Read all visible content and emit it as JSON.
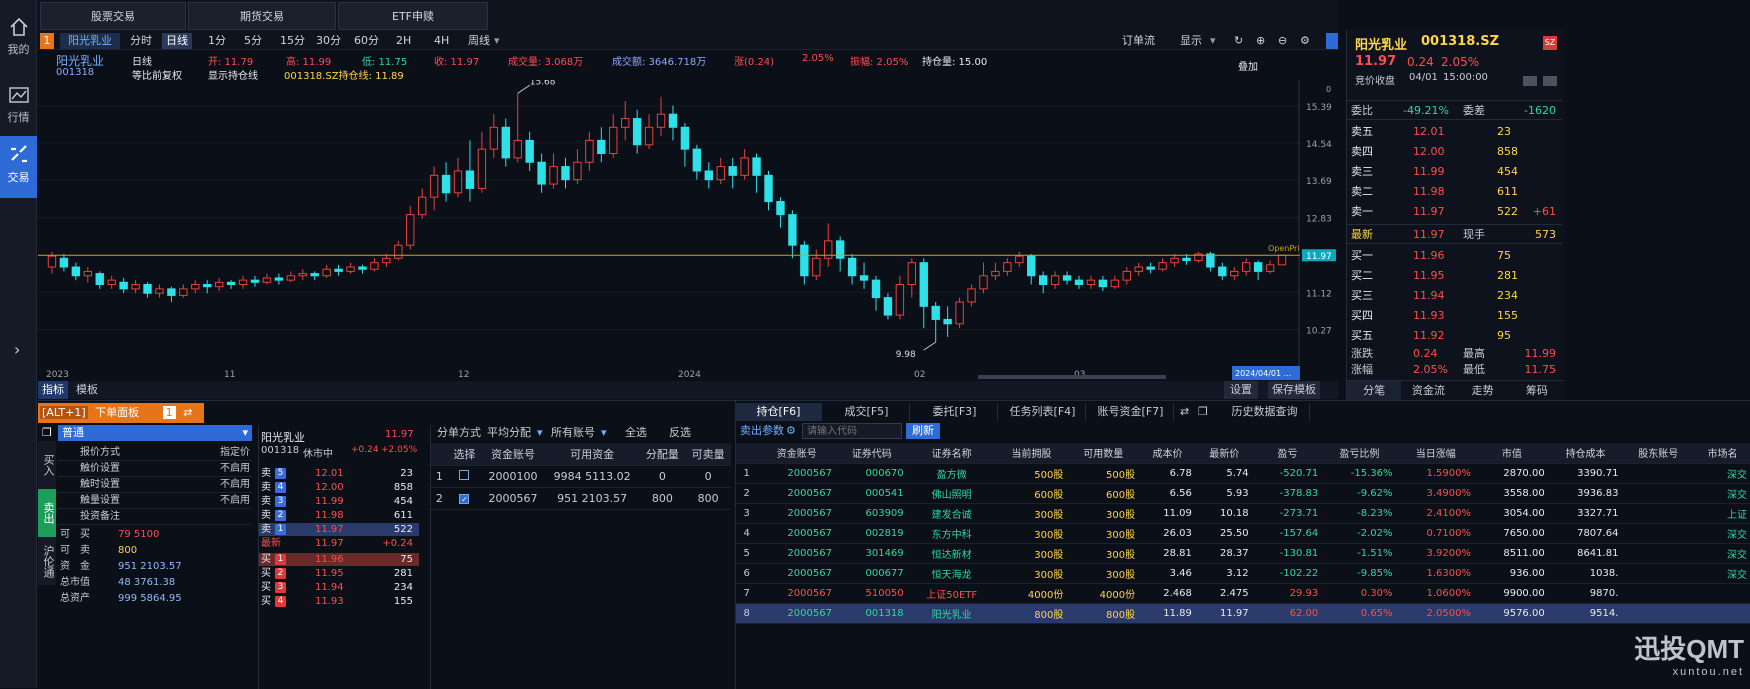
{
  "nav": [
    {
      "label": "我的"
    },
    {
      "label": "行情"
    },
    {
      "label": "交易"
    }
  ],
  "top_tabs": [
    "股票交易",
    "期货交易",
    "ETF申赎"
  ],
  "toolbar": {
    "badge": "1",
    "stock": "阳光乳业",
    "periods": [
      "分时",
      "日线",
      "1分",
      "5分",
      "15分",
      "30分",
      "60分",
      "2H",
      "4H",
      "周线"
    ],
    "selected": "日线",
    "order_flow": "订单流",
    "display": "显示"
  },
  "info": {
    "name": "阳光乳业",
    "code": "001318",
    "line": "日线",
    "adjust": "等比前复权",
    "open": "开: 11.79",
    "high": "高: 11.99",
    "low": "低: 11.75",
    "close": "收: 11.97",
    "volume": "成交量: 3.068万",
    "amount": "成交额: 3646.718万",
    "change": "涨(0.24)",
    "pct": "2.05%",
    "amp": "振幅: 2.05%",
    "position": "持仓量: 15.00",
    "show_cost": "显示持仓线",
    "cost_line": "001318.SZ持仓线: 11.89",
    "overlay": "叠加"
  },
  "chart_data": {
    "type": "candlestick",
    "x_ticks": [
      "2023",
      "11",
      "12",
      "2024",
      "02",
      "03"
    ],
    "y_ticks": [
      "15.39",
      "14.54",
      "13.69",
      "12.83",
      "11.97",
      "11.12",
      "10.27"
    ],
    "ylim": [
      9.8,
      15.8
    ],
    "max_label": "15.68",
    "min_label": "9.98",
    "hline": 11.97,
    "hline_label": "OpenPri",
    "last_date": "2024/04/01 ...",
    "current_tag": "11.97",
    "candles": [
      [
        11.7,
        11.95,
        11.55,
        12.05
      ],
      [
        11.9,
        11.7,
        11.6,
        12.0
      ],
      [
        11.7,
        11.5,
        11.4,
        11.8
      ],
      [
        11.5,
        11.6,
        11.35,
        11.7
      ],
      [
        11.55,
        11.3,
        11.2,
        11.6
      ],
      [
        11.3,
        11.4,
        11.2,
        11.5
      ],
      [
        11.35,
        11.2,
        11.1,
        11.45
      ],
      [
        11.2,
        11.3,
        11.1,
        11.4
      ],
      [
        11.3,
        11.1,
        11.0,
        11.35
      ],
      [
        11.1,
        11.2,
        11.0,
        11.3
      ],
      [
        11.2,
        11.05,
        10.9,
        11.25
      ],
      [
        11.05,
        11.2,
        11.0,
        11.3
      ],
      [
        11.2,
        11.3,
        11.1,
        11.4
      ],
      [
        11.3,
        11.25,
        11.1,
        11.4
      ],
      [
        11.25,
        11.35,
        11.15,
        11.45
      ],
      [
        11.35,
        11.3,
        11.2,
        11.4
      ],
      [
        11.3,
        11.4,
        11.2,
        11.5
      ],
      [
        11.4,
        11.35,
        11.25,
        11.5
      ],
      [
        11.35,
        11.45,
        11.3,
        11.55
      ],
      [
        11.45,
        11.4,
        11.3,
        11.55
      ],
      [
        11.4,
        11.5,
        11.35,
        11.6
      ],
      [
        11.5,
        11.55,
        11.4,
        11.65
      ],
      [
        11.55,
        11.5,
        11.4,
        11.6
      ],
      [
        11.5,
        11.65,
        11.45,
        11.75
      ],
      [
        11.65,
        11.6,
        11.5,
        11.75
      ],
      [
        11.6,
        11.7,
        11.55,
        11.8
      ],
      [
        11.7,
        11.65,
        11.55,
        11.75
      ],
      [
        11.65,
        11.8,
        11.6,
        11.9
      ],
      [
        11.8,
        11.9,
        11.7,
        12.0
      ],
      [
        11.9,
        12.2,
        11.85,
        12.3
      ],
      [
        12.2,
        12.9,
        12.1,
        13.1
      ],
      [
        12.9,
        13.3,
        12.8,
        13.5
      ],
      [
        13.3,
        13.8,
        13.0,
        14.0
      ],
      [
        13.8,
        13.4,
        13.2,
        14.1
      ],
      [
        13.4,
        13.9,
        13.3,
        14.2
      ],
      [
        13.9,
        13.5,
        13.2,
        14.6
      ],
      [
        13.5,
        14.4,
        13.4,
        14.8
      ],
      [
        14.4,
        14.9,
        14.2,
        15.2
      ],
      [
        14.9,
        14.2,
        14.0,
        15.1
      ],
      [
        14.2,
        14.6,
        14.1,
        15.68
      ],
      [
        14.6,
        14.1,
        13.9,
        14.8
      ],
      [
        14.1,
        13.6,
        13.4,
        14.3
      ],
      [
        13.6,
        14.0,
        13.5,
        14.3
      ],
      [
        14.0,
        13.7,
        13.5,
        14.2
      ],
      [
        13.7,
        14.1,
        13.6,
        14.4
      ],
      [
        14.1,
        14.6,
        13.9,
        14.8
      ],
      [
        14.6,
        14.3,
        14.1,
        14.9
      ],
      [
        14.3,
        14.9,
        14.2,
        15.2
      ],
      [
        14.9,
        15.1,
        14.6,
        15.5
      ],
      [
        15.1,
        14.5,
        14.3,
        15.3
      ],
      [
        14.5,
        14.9,
        14.4,
        15.2
      ],
      [
        14.9,
        15.2,
        14.7,
        15.6
      ],
      [
        15.2,
        14.9,
        14.6,
        15.4
      ],
      [
        14.9,
        14.4,
        14.0,
        15.0
      ],
      [
        14.4,
        13.9,
        13.7,
        14.5
      ],
      [
        13.9,
        13.7,
        13.5,
        14.1
      ],
      [
        13.7,
        14.0,
        13.6,
        14.2
      ],
      [
        14.0,
        13.8,
        13.5,
        14.2
      ],
      [
        13.8,
        14.2,
        13.7,
        14.4
      ],
      [
        14.2,
        13.8,
        13.4,
        14.3
      ],
      [
        13.8,
        13.2,
        13.0,
        13.9
      ],
      [
        13.2,
        12.9,
        12.6,
        13.3
      ],
      [
        12.9,
        12.2,
        11.9,
        13.0
      ],
      [
        12.2,
        11.5,
        11.3,
        12.3
      ],
      [
        11.5,
        11.9,
        11.4,
        12.1
      ],
      [
        11.9,
        12.3,
        11.7,
        12.7
      ],
      [
        12.3,
        11.9,
        11.6,
        12.4
      ],
      [
        11.9,
        11.5,
        11.3,
        12.0
      ],
      [
        11.5,
        11.4,
        11.2,
        11.8
      ],
      [
        11.4,
        11.0,
        10.7,
        11.5
      ],
      [
        11.0,
        10.6,
        10.5,
        11.1
      ],
      [
        10.6,
        11.3,
        10.5,
        11.5
      ],
      [
        11.3,
        11.8,
        11.0,
        11.9
      ],
      [
        11.8,
        10.8,
        10.3,
        11.9
      ],
      [
        10.8,
        10.5,
        9.98,
        10.9
      ],
      [
        10.5,
        10.4,
        10.1,
        10.8
      ],
      [
        10.4,
        10.9,
        10.3,
        11.0
      ],
      [
        10.9,
        11.2,
        10.8,
        11.3
      ],
      [
        11.2,
        11.5,
        11.1,
        11.8
      ],
      [
        11.5,
        11.6,
        11.4,
        11.8
      ],
      [
        11.6,
        11.8,
        11.5,
        11.9
      ],
      [
        11.8,
        11.95,
        11.7,
        12.05
      ],
      [
        11.95,
        11.5,
        11.3,
        12.0
      ],
      [
        11.5,
        11.3,
        11.1,
        11.6
      ],
      [
        11.3,
        11.5,
        11.2,
        11.6
      ],
      [
        11.5,
        11.4,
        11.3,
        11.6
      ],
      [
        11.4,
        11.3,
        11.2,
        11.5
      ],
      [
        11.3,
        11.4,
        11.2,
        11.5
      ],
      [
        11.4,
        11.25,
        11.15,
        11.5
      ],
      [
        11.25,
        11.4,
        11.2,
        11.5
      ],
      [
        11.4,
        11.6,
        11.3,
        11.7
      ],
      [
        11.6,
        11.7,
        11.5,
        11.8
      ],
      [
        11.7,
        11.65,
        11.55,
        11.8
      ],
      [
        11.65,
        11.8,
        11.6,
        11.9
      ],
      [
        11.8,
        11.9,
        11.7,
        12.0
      ],
      [
        11.9,
        11.85,
        11.75,
        12.0
      ],
      [
        11.85,
        12.0,
        11.8,
        12.05
      ],
      [
        12.0,
        11.7,
        11.6,
        12.05
      ],
      [
        11.7,
        11.5,
        11.4,
        11.8
      ],
      [
        11.5,
        11.6,
        11.4,
        11.7
      ],
      [
        11.6,
        11.8,
        11.5,
        11.9
      ],
      [
        11.8,
        11.6,
        11.4,
        11.85
      ],
      [
        11.6,
        11.75,
        11.55,
        11.85
      ],
      [
        11.75,
        11.97,
        11.75,
        11.99
      ]
    ]
  },
  "indicator_bar": {
    "tabs": [
      "指标",
      "模板"
    ],
    "settings": "设置",
    "save": "保存模板"
  },
  "right": {
    "name": "阳光乳业",
    "code": "001318.SZ",
    "price": "11.97",
    "chg": "0.24",
    "pct": "2.05%",
    "auction": "竞价收盘",
    "date": "04/01",
    "time": "15:00:00",
    "weibi_label": "委比",
    "weibi": "-49.21%",
    "weicha_label": "委差",
    "weicha": "-1620",
    "asks": [
      {
        "l": "卖五",
        "p": "12.01",
        "v": "23",
        "d": ""
      },
      {
        "l": "卖四",
        "p": "12.00",
        "v": "858",
        "d": ""
      },
      {
        "l": "卖三",
        "p": "11.99",
        "v": "454",
        "d": ""
      },
      {
        "l": "卖二",
        "p": "11.98",
        "v": "611",
        "d": ""
      },
      {
        "l": "卖一",
        "p": "11.97",
        "v": "522",
        "d": "+61"
      }
    ],
    "last_label": "最新",
    "last": "11.97",
    "hand_label": "现手",
    "hand": "573",
    "bids": [
      {
        "l": "买一",
        "p": "11.96",
        "v": "75"
      },
      {
        "l": "买二",
        "p": "11.95",
        "v": "281"
      },
      {
        "l": "买三",
        "p": "11.94",
        "v": "234"
      },
      {
        "l": "买四",
        "p": "11.93",
        "v": "155"
      },
      {
        "l": "买五",
        "p": "11.92",
        "v": "95"
      }
    ],
    "stats": [
      {
        "a": "涨跌",
        "b": "0.24",
        "c": "最高",
        "d": "11.99"
      },
      {
        "a": "涨幅",
        "b": "2.05%",
        "c": "最低",
        "d": "11.75"
      }
    ],
    "tabs": [
      "分笔",
      "资金流",
      "走势",
      "筹码"
    ]
  },
  "order": {
    "alt": "[ALT+1]",
    "panel": "下单面板",
    "badge": "1",
    "side_tabs": [
      "买入",
      "卖出",
      "沪伦通"
    ],
    "type": "普通",
    "rows": [
      {
        "k": "报价方式",
        "v": "指定价"
      },
      {
        "k": "触价设置",
        "v": "不启用"
      },
      {
        "k": "触时设置",
        "v": "不启用"
      },
      {
        "k": "触量设置",
        "v": "不启用"
      },
      {
        "k": "投资备注",
        "v": ""
      }
    ],
    "acct": [
      {
        "k": "可　买",
        "v": "79 5100"
      },
      {
        "k": "可　卖",
        "v": "800"
      },
      {
        "k": "资　金",
        "v": "951 2103.57"
      },
      {
        "k": "总市值",
        "v": "48 3761.38"
      },
      {
        "k": "总资产",
        "v": "999 5864.95"
      }
    ]
  },
  "quote": {
    "name": "阳光乳业",
    "price": "11.97",
    "code": "001318",
    "status": "休市中",
    "chg": "+0.24",
    "pct": "+2.05%",
    "asks": [
      {
        "l": "卖",
        "n": "5",
        "p": "12.01",
        "v": "23"
      },
      {
        "l": "卖",
        "n": "4",
        "p": "12.00",
        "v": "858"
      },
      {
        "l": "卖",
        "n": "3",
        "p": "11.99",
        "v": "454"
      },
      {
        "l": "卖",
        "n": "2",
        "p": "11.98",
        "v": "611"
      },
      {
        "l": "卖",
        "n": "1",
        "p": "11.97",
        "v": "522"
      }
    ],
    "last_label": "最新",
    "last": "11.97",
    "last_chg": "+0.24",
    "bids": [
      {
        "l": "买",
        "n": "1",
        "p": "11.96",
        "v": "75"
      },
      {
        "l": "买",
        "n": "2",
        "p": "11.95",
        "v": "281"
      },
      {
        "l": "买",
        "n": "3",
        "p": "11.94",
        "v": "234"
      },
      {
        "l": "买",
        "n": "4",
        "p": "11.93",
        "v": "155"
      }
    ]
  },
  "split": {
    "label": "分单方式",
    "mode": "平均分配",
    "accounts": "所有账号",
    "all": "全选",
    "invert": "反选",
    "headers": [
      "选择",
      "资金账号",
      "可用资金",
      "分配量",
      "可卖量"
    ],
    "rows": [
      {
        "i": "1",
        "acc": "2000100",
        "cash": "9984 5113.02",
        "alloc": "0",
        "sell": "0",
        "checked": false
      },
      {
        "i": "2",
        "acc": "2000567",
        "cash": "951 2103.57",
        "alloc": "800",
        "sell": "800",
        "checked": true
      }
    ]
  },
  "holdings": {
    "tabs": [
      "持仓[F6]",
      "成交[F5]",
      "委托[F3]",
      "任务列表[F4]",
      "账号资金[F7]",
      "历史数据查询"
    ],
    "sell_param": "卖出参数",
    "placeholder": "请输入代码",
    "refresh": "刷新",
    "headers": [
      "",
      "资金账号",
      "证券代码",
      "证券名称",
      "当前拥股",
      "可用数量",
      "成本价",
      "最新价",
      "盈亏",
      "盈亏比例",
      "当日涨幅",
      "市值",
      "持仓成本",
      "股东账号",
      "市场名"
    ],
    "rows": [
      [
        "1",
        "2000567",
        "000670",
        "盈方微",
        "500股",
        "500股",
        "6.78",
        "5.74",
        "-520.71",
        "-15.36%",
        "1.5900%",
        "2870.00",
        "3390.71",
        "",
        "深交"
      ],
      [
        "2",
        "2000567",
        "000541",
        "佛山照明",
        "600股",
        "600股",
        "6.56",
        "5.93",
        "-378.83",
        "-9.62%",
        "3.4900%",
        "3558.00",
        "3936.83",
        "",
        "深交"
      ],
      [
        "3",
        "2000567",
        "603909",
        "建发合诚",
        "300股",
        "300股",
        "11.09",
        "10.18",
        "-273.71",
        "-8.23%",
        "2.4100%",
        "3054.00",
        "3327.71",
        "",
        "上证"
      ],
      [
        "4",
        "2000567",
        "002819",
        "东方中科",
        "300股",
        "300股",
        "26.03",
        "25.50",
        "-157.64",
        "-2.02%",
        "0.7100%",
        "7650.00",
        "7807.64",
        "",
        "深交"
      ],
      [
        "5",
        "2000567",
        "301469",
        "恒达新材",
        "300股",
        "300股",
        "28.81",
        "28.37",
        "-130.81",
        "-1.51%",
        "3.9200%",
        "8511.00",
        "8641.81",
        "",
        "深交"
      ],
      [
        "6",
        "2000567",
        "000677",
        "恒天海龙",
        "300股",
        "300股",
        "3.46",
        "3.12",
        "-102.22",
        "-9.85%",
        "1.6300%",
        "936.00",
        "1038.",
        "",
        "深交"
      ],
      [
        "7",
        "2000567",
        "510050",
        "上证50ETF",
        "4000份",
        "4000份",
        "2.468",
        "2.475",
        "29.93",
        "0.30%",
        "1.0600%",
        "9900.00",
        "9870.",
        "",
        ""
      ],
      [
        "8",
        "2000567",
        "001318",
        "阳光乳业",
        "800股",
        "800股",
        "11.89",
        "11.97",
        "62.00",
        "0.65%",
        "2.0500%",
        "9576.00",
        "9514.",
        "",
        ""
      ]
    ]
  },
  "watermark": {
    "brand": "迅投QMT",
    "url": "xuntou.net"
  }
}
